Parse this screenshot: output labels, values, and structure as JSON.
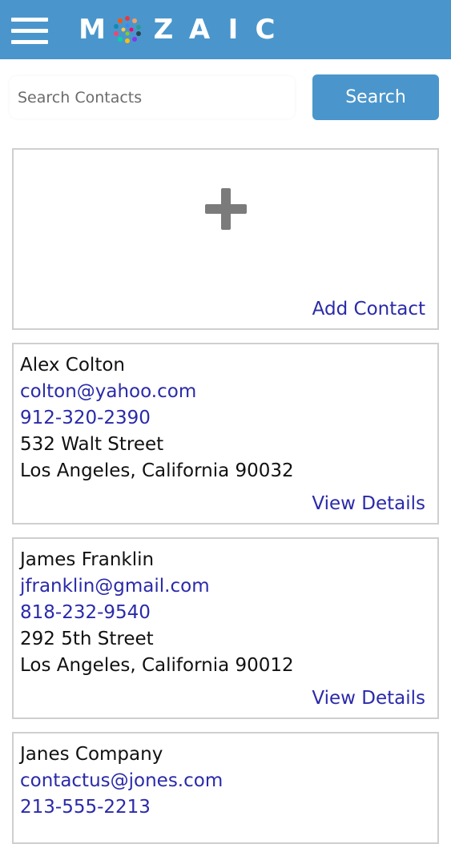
{
  "header": {
    "logo_letters": [
      "M",
      "Z",
      "A",
      "I",
      "C"
    ],
    "brand_color": "#4a96cc"
  },
  "search": {
    "placeholder": "Search Contacts",
    "value": "",
    "button_label": "Search"
  },
  "add_card": {
    "icon": "plus-icon",
    "link_label": "Add Contact"
  },
  "contacts": [
    {
      "name": "Alex Colton",
      "email": "colton@yahoo.com",
      "phone": "912-320-2390",
      "street": "532 Walt Street",
      "city_line": "Los Angeles, California 90032",
      "link_label": "View Details"
    },
    {
      "name": "James Franklin",
      "email": "jfranklin@gmail.com",
      "phone": "818-232-9540",
      "street": "292 5th Street",
      "city_line": "Los Angeles, California 90012",
      "link_label": "View Details"
    },
    {
      "name": "Janes Company",
      "email": "contactus@jones.com",
      "phone": "213-555-2213"
    }
  ]
}
